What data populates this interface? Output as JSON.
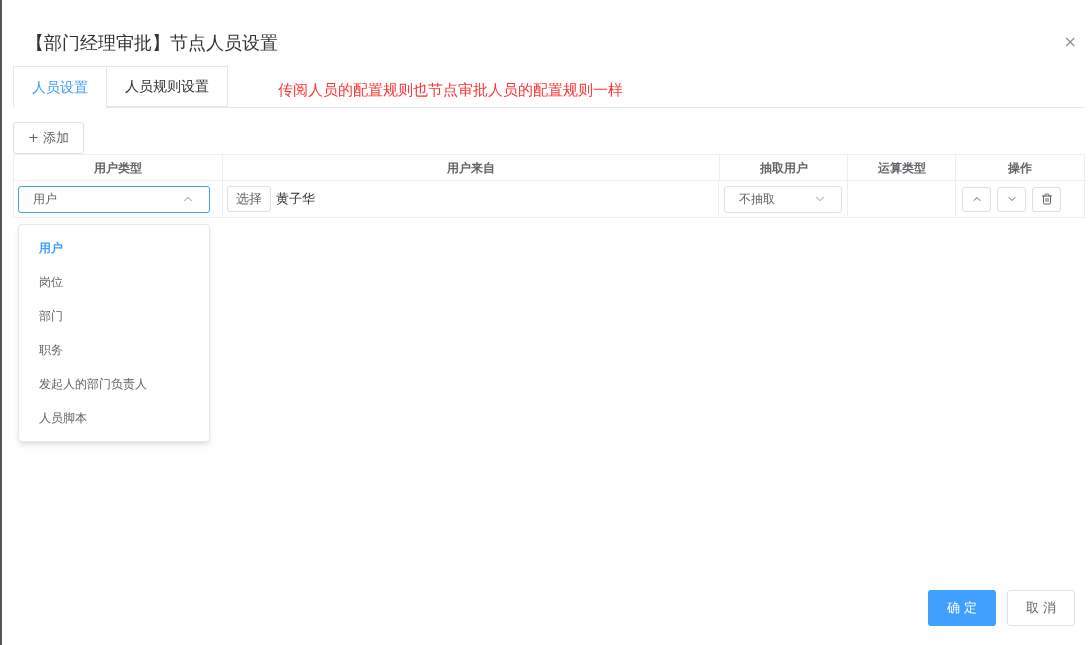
{
  "dialog": {
    "title": "【部门经理审批】节点人员设置",
    "close": "×"
  },
  "tabs": [
    {
      "label": "人员设置",
      "selected": true
    },
    {
      "label": "人员规则设置",
      "selected": false
    }
  ],
  "note": "传阅人员的配置规则也节点审批人员的配置规则一样",
  "add_button": {
    "icon": "+",
    "label": "添加"
  },
  "table": {
    "columns": [
      "用户类型",
      "用户来自",
      "抽取用户",
      "运算类型",
      "操作"
    ],
    "rows": [
      {
        "user_type": "用户",
        "select_button": "选择",
        "source": "黄子华",
        "extract": "不抽取"
      }
    ]
  },
  "dropdown": {
    "open": true,
    "options": [
      {
        "label": "用户",
        "selected": true
      },
      {
        "label": "岗位",
        "selected": false
      },
      {
        "label": "部门",
        "selected": false
      },
      {
        "label": "职务",
        "selected": false
      },
      {
        "label": "发起人的部门负责人",
        "selected": false
      },
      {
        "label": "人员脚本",
        "selected": false
      }
    ]
  },
  "footer": {
    "confirm": "确 定",
    "cancel": "取 消"
  }
}
